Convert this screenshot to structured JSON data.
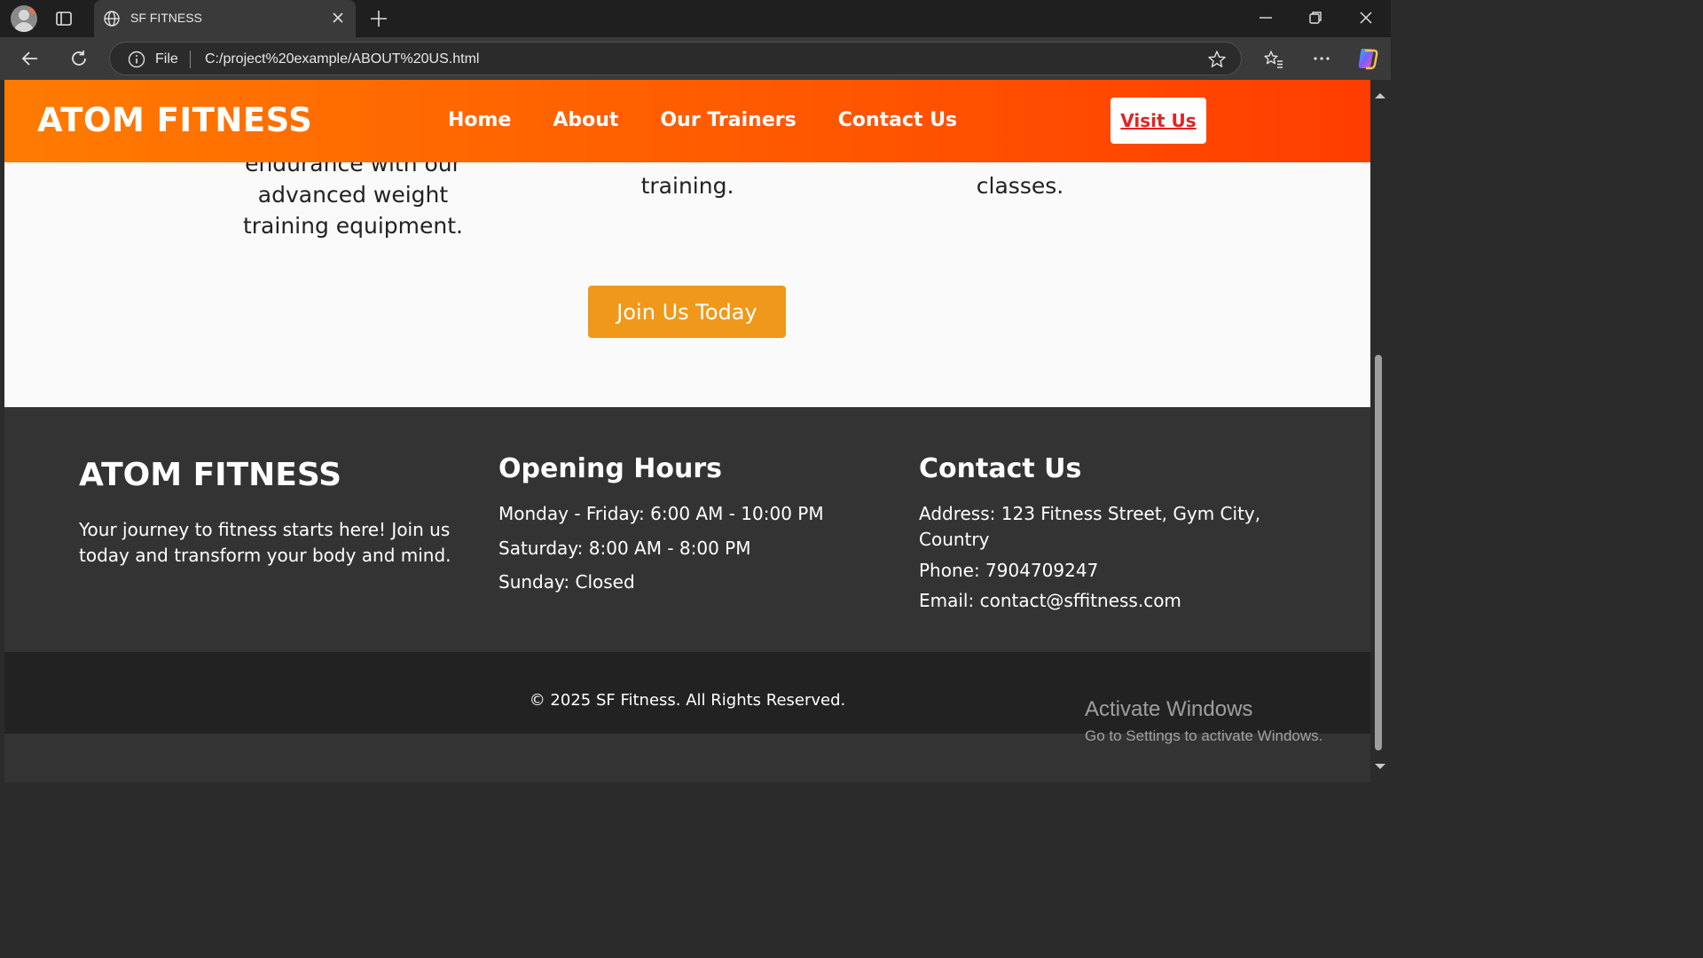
{
  "browser": {
    "tab_title": "SF FITNESS",
    "address_scheme": "File",
    "url": "C:/project%20example/ABOUT%20US.html"
  },
  "site": {
    "logo": "ATOM FITNESS",
    "nav": [
      "Home",
      "About",
      "Our Trainers",
      "Contact Us"
    ],
    "visit_button": "Visit Us",
    "features": [
      [
        "endurance with our",
        "advanced weight",
        "training equipment."
      ],
      [
        "training."
      ],
      [
        "classes."
      ]
    ],
    "join_button": "Join Us Today"
  },
  "footer": {
    "brand": "ATOM FITNESS",
    "tagline": "Your journey to fitness starts here! Join us today and transform your body and mind.",
    "hours_title": "Opening Hours",
    "hours": [
      "Monday - Friday: 6:00 AM - 10:00 PM",
      "Saturday: 8:00 AM - 8:00 PM",
      "Sunday: Closed"
    ],
    "contact_title": "Contact Us",
    "address": "Address: 123 Fitness Street, Gym City, Country",
    "phone": "Phone: 7904709247",
    "email": "Email: contact@sffitness.com",
    "copyright": "© 2025 SF Fitness. All Rights Reserved."
  },
  "watermark": {
    "title": "Activate Windows",
    "subtitle": "Go to Settings to activate Windows."
  },
  "colors": {
    "header_start": "#ff7b00",
    "header_end": "#ff3d00",
    "join_button": "#f0981a",
    "visit_text": "#e02424",
    "footer_bg": "#333333",
    "copyright_bg": "#222222"
  },
  "icons": [
    "profile-avatar",
    "tab-actions-icon",
    "globe-icon",
    "close-icon",
    "plus-icon",
    "minimize-icon",
    "restore-icon",
    "back-arrow-icon",
    "reload-icon",
    "info-icon",
    "star-icon",
    "favorites-icon",
    "more-icon",
    "copilot-icon"
  ]
}
